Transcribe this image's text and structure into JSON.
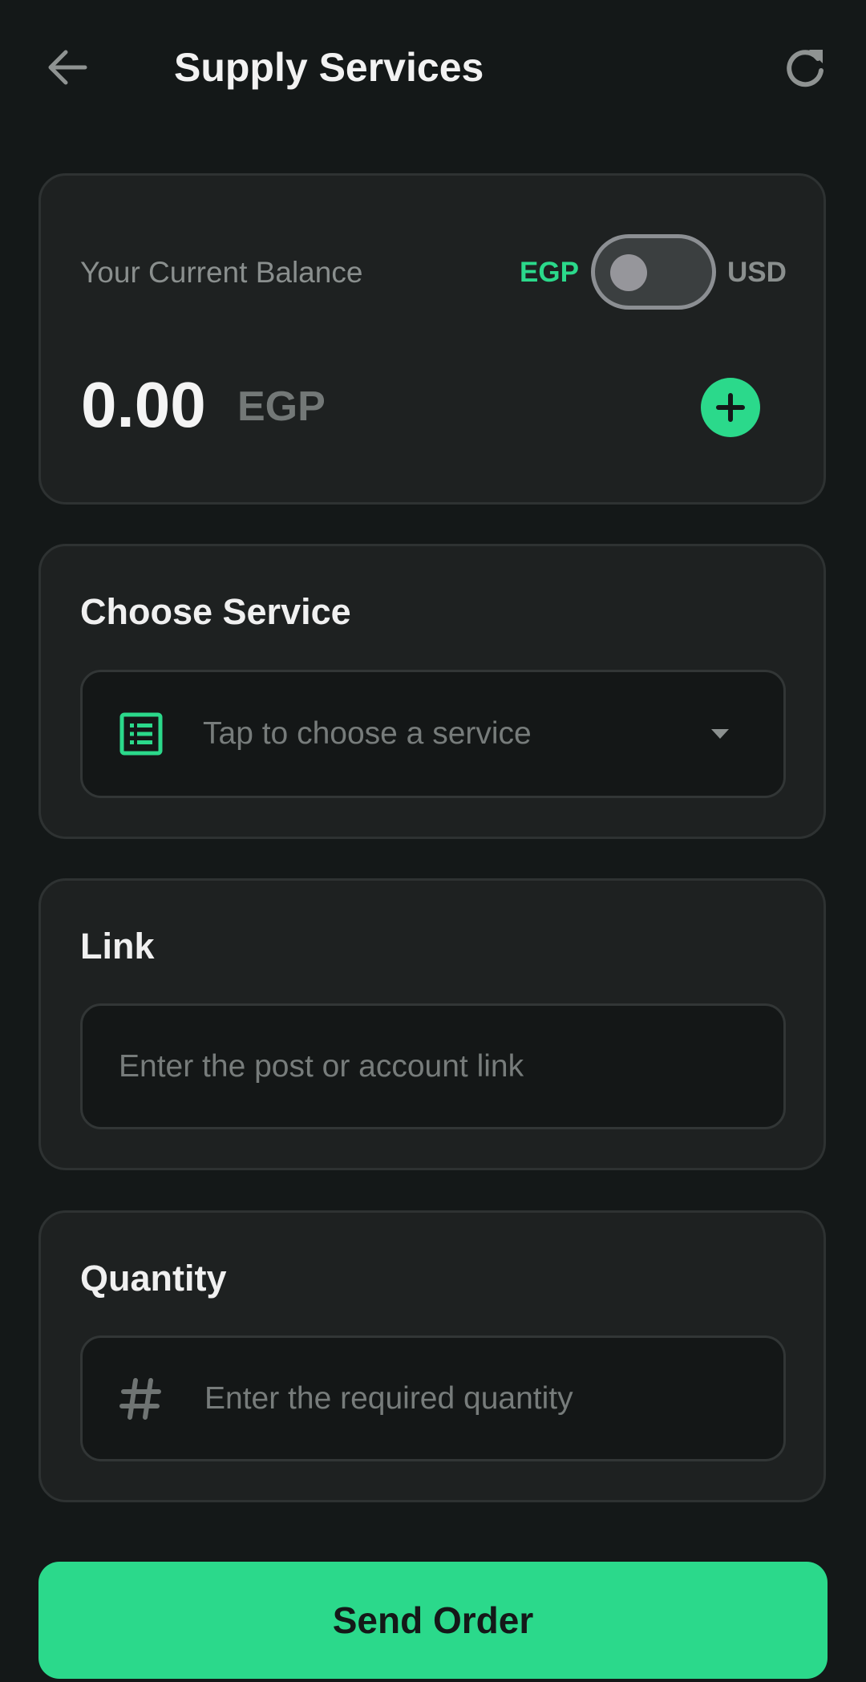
{
  "header": {
    "title": "Supply Services",
    "back_icon": "arrow-left-icon",
    "refresh_icon": "refresh-icon"
  },
  "balance": {
    "label": "Your Current Balance",
    "currency_left": "EGP",
    "currency_right": "USD",
    "toggle_state": "EGP",
    "amount": "0.00",
    "currency": "EGP",
    "add_icon": "plus-circle-icon"
  },
  "service": {
    "title": "Choose Service",
    "placeholder": "Tap to choose a service",
    "icon": "list-icon",
    "caret_icon": "caret-down-icon"
  },
  "link": {
    "title": "Link",
    "placeholder": "Enter the post or account link"
  },
  "quantity": {
    "title": "Quantity",
    "placeholder": "Enter the required quantity",
    "icon": "hash-icon"
  },
  "actions": {
    "send_label": "Send Order"
  },
  "colors": {
    "background": "#141818",
    "card": "#1e2121",
    "accent": "#2bd98b",
    "muted_text": "#8a8f8e"
  }
}
